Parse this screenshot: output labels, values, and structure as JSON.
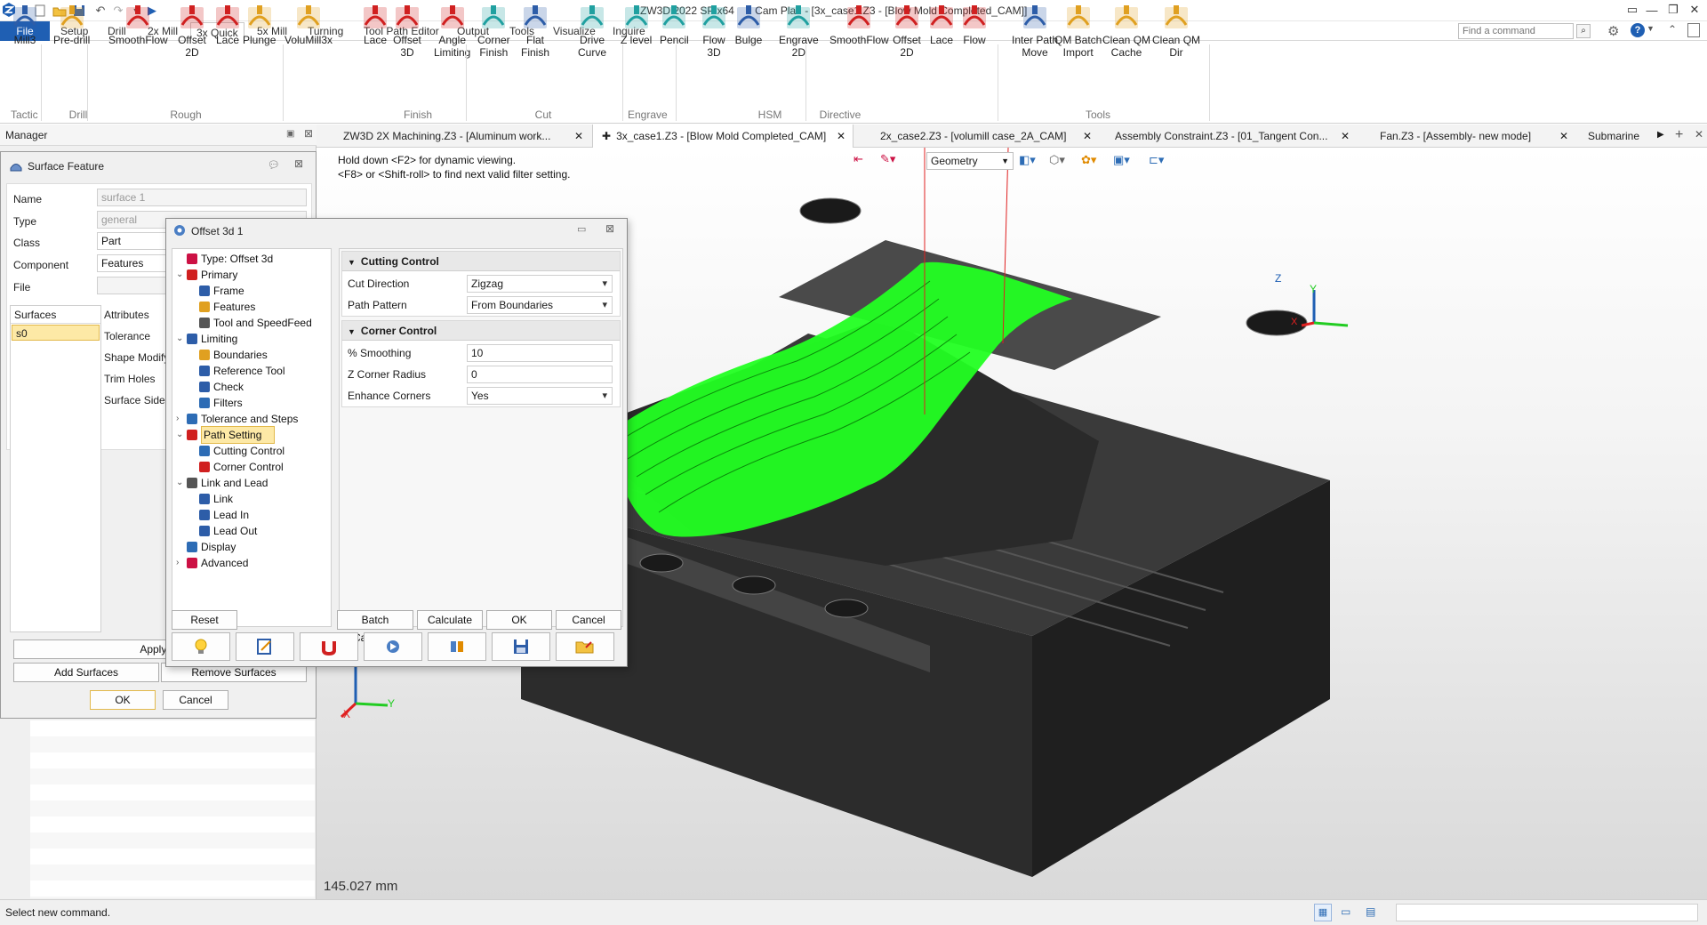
{
  "window": {
    "title": "ZW3D 2022 SP x64       Cam Plan - [3x_case1.Z3 - [Blow Mold Completed_CAM]]"
  },
  "menu": {
    "tabs": [
      "File",
      "Setup",
      "Drill",
      "2x Mill",
      "3x Quick",
      "5x Mill",
      "Turning",
      "Tool Path Editor",
      "Output",
      "Tools",
      "Visualize",
      "Inquire"
    ],
    "active": "3x Quick",
    "search_placeholder": "Find a command"
  },
  "ribbon": {
    "buttons": [
      {
        "label": "Mill3",
        "icon": "mill3-icon"
      },
      {
        "label": "Pre-drill",
        "icon": "predrill-icon"
      },
      {
        "label": "SmoothFlow",
        "icon": "smoothflow-icon"
      },
      {
        "label": "Offset\n2D",
        "icon": "offset2d-icon"
      },
      {
        "label": "Lace",
        "icon": "lace-icon"
      },
      {
        "label": "Plunge",
        "icon": "plunge-icon"
      },
      {
        "label": "VoluMill3x",
        "icon": "volumill-icon"
      },
      {
        "label": "Lace",
        "icon": "lace-icon"
      },
      {
        "label": "Offset\n3D",
        "icon": "offset3d-icon"
      },
      {
        "label": "Angle\nLimiting",
        "icon": "angle-limiting-icon"
      },
      {
        "label": "Corner\nFinish",
        "icon": "corner-finish-icon"
      },
      {
        "label": "Flat\nFinish",
        "icon": "flat-finish-icon"
      },
      {
        "label": "Drive\nCurve",
        "icon": "drive-curve-icon"
      },
      {
        "label": "Z level",
        "icon": "zlevel-icon"
      },
      {
        "label": "Pencil",
        "icon": "pencil-icon"
      },
      {
        "label": "Flow\n3D",
        "icon": "flow3d-icon"
      },
      {
        "label": "Bulge",
        "icon": "bulge-icon"
      },
      {
        "label": "Engrave\n2D",
        "icon": "engrave-icon"
      },
      {
        "label": "SmoothFlow",
        "icon": "smoothflow-icon"
      },
      {
        "label": "Offset\n2D",
        "icon": "offset2d-icon"
      },
      {
        "label": "Lace",
        "icon": "lace-icon"
      },
      {
        "label": "Flow",
        "icon": "flow-icon"
      },
      {
        "label": "Inter Path\nMove",
        "icon": "inter-path-icon"
      },
      {
        "label": "QM Batch\nImport",
        "icon": "qm-batch-icon"
      },
      {
        "label": "Clean QM\nCache",
        "icon": "clean-cache-icon"
      },
      {
        "label": "Clean QM\nDir",
        "icon": "clean-dir-icon"
      }
    ],
    "groups": [
      "Tactic",
      "Drill",
      "Rough",
      "Finish",
      "Cut",
      "Engrave",
      "HSM",
      "Directive",
      "Tools"
    ]
  },
  "manager": {
    "title": "Manager",
    "surface_feature": {
      "title": "Surface Feature",
      "fields": [
        {
          "label": "Name",
          "value": "surface 1"
        },
        {
          "label": "Type",
          "value": "general"
        },
        {
          "label": "Class",
          "value": "Part"
        },
        {
          "label": "Component",
          "value": "Features"
        },
        {
          "label": "File",
          "value": ""
        }
      ],
      "surfaces_header": "Surfaces",
      "surface_item": "s0",
      "attributes_header": "Attributes",
      "attributes": [
        "Tolerance",
        "Shape Modify",
        "Trim Holes",
        "Surface Side"
      ],
      "apply_label": "Apply Attr",
      "add_label": "Add Surfaces",
      "remove_label": "Remove Surfaces",
      "ok_label": "OK",
      "cancel_label": "Cancel"
    }
  },
  "doc_tabs": [
    {
      "label": "ZW3D 2X Machining.Z3 - [Aluminum work...",
      "active": false
    },
    {
      "label": "3x_case1.Z3 - [Blow Mold Completed_CAM]",
      "active": true
    },
    {
      "label": "2x_case2.Z3 - [volumill case_2A_CAM]",
      "active": false
    },
    {
      "label": "Assembly Constraint.Z3 - [01_Tangent Con...",
      "active": false
    },
    {
      "label": "Fan.Z3 - [Assembly- new mode]",
      "active": false
    },
    {
      "label": "Submarine",
      "active": false
    }
  ],
  "viewport": {
    "hint": "Hold down <F2> for dynamic viewing.\n<F8> or <Shift-roll> to find next valid filter setting.",
    "filter": "Geometry",
    "measure": "145.027 mm",
    "axis_x": "X",
    "axis_y": "Y",
    "axis_z": "Z"
  },
  "dialog": {
    "title": "Offset 3d 1",
    "tree": [
      {
        "label": "Type: Offset 3d",
        "level": 0,
        "exp": "",
        "icon": "type-icon"
      },
      {
        "label": "Primary",
        "level": 0,
        "exp": "v",
        "icon": "primary-icon"
      },
      {
        "label": "Frame",
        "level": 1,
        "exp": "",
        "icon": "frame-icon"
      },
      {
        "label": "Features",
        "level": 1,
        "exp": "",
        "icon": "features-icon"
      },
      {
        "label": "Tool and SpeedFeed",
        "level": 1,
        "exp": "",
        "icon": "tool-icon"
      },
      {
        "label": "Limiting",
        "level": 0,
        "exp": "v",
        "icon": "limiting-icon"
      },
      {
        "label": "Boundaries",
        "level": 1,
        "exp": "",
        "icon": "boundaries-icon"
      },
      {
        "label": "Reference Tool",
        "level": 1,
        "exp": "",
        "icon": "reference-tool-icon"
      },
      {
        "label": "Check",
        "level": 1,
        "exp": "",
        "icon": "check-icon"
      },
      {
        "label": "Filters",
        "level": 1,
        "exp": "",
        "icon": "filters-icon"
      },
      {
        "label": "Tolerance and Steps",
        "level": 0,
        "exp": ">",
        "icon": "tolerance-icon"
      },
      {
        "label": "Path Setting",
        "level": 0,
        "exp": "v",
        "icon": "path-setting-icon",
        "selected": true
      },
      {
        "label": "Cutting Control",
        "level": 1,
        "exp": "",
        "icon": "cutting-control-icon"
      },
      {
        "label": "Corner Control",
        "level": 1,
        "exp": "",
        "icon": "corner-control-icon"
      },
      {
        "label": "Link and Lead",
        "level": 0,
        "exp": "v",
        "icon": "link-lead-icon"
      },
      {
        "label": "Link",
        "level": 1,
        "exp": "",
        "icon": "link-icon"
      },
      {
        "label": "Lead In",
        "level": 1,
        "exp": "",
        "icon": "lead-in-icon"
      },
      {
        "label": "Lead Out",
        "level": 1,
        "exp": "",
        "icon": "lead-out-icon"
      },
      {
        "label": "Display",
        "level": 0,
        "exp": "",
        "icon": "display-icon"
      },
      {
        "label": "Advanced",
        "level": 0,
        "exp": ">",
        "icon": "advanced-icon"
      }
    ],
    "cutting_control": {
      "title": "Cutting Control",
      "rows": [
        {
          "label": "Cut Direction",
          "value": "Zigzag",
          "combo": true
        },
        {
          "label": "Path Pattern",
          "value": "From Boundaries",
          "combo": true
        }
      ]
    },
    "corner_control": {
      "title": "Corner Control",
      "rows": [
        {
          "label": "% Smoothing",
          "value": "10",
          "combo": false
        },
        {
          "label": "Z Corner Radius",
          "value": "0",
          "combo": false
        },
        {
          "label": "Enhance Corners",
          "value": "Yes",
          "combo": true
        }
      ]
    },
    "buttons": {
      "reset": "Reset",
      "batch": "Batch Calculate",
      "calculate": "Calculate",
      "ok": "OK",
      "cancel": "Cancel"
    },
    "icon_buttons": [
      "bulb-icon",
      "edit-icon",
      "magnet-icon",
      "simulate-icon",
      "verify-icon",
      "save-icon",
      "folder-icon"
    ]
  },
  "status": {
    "text": "Select new command."
  },
  "colors": {
    "accent": "#1f5fb3",
    "toolpath": "#22ff22",
    "model": "#3c3c3c",
    "selection": "#fde9a6"
  }
}
